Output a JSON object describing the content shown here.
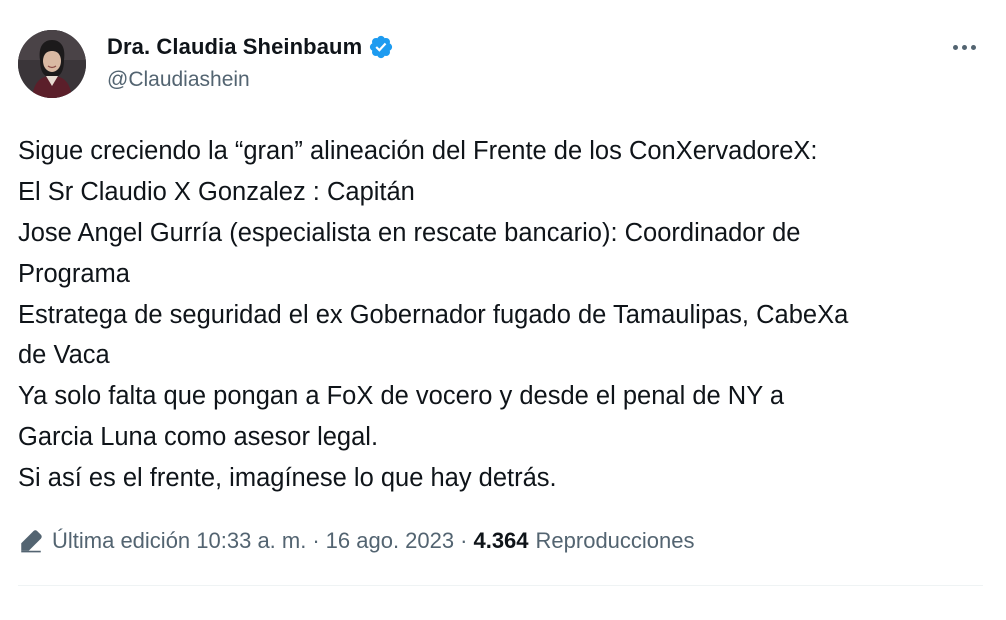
{
  "author": {
    "display_name": "Dra. Claudia Sheinbaum",
    "handle": "@Claudiashein",
    "verified": true,
    "avatar_icon": "profile-photo"
  },
  "tweet": {
    "lines": [
      "Sigue creciendo la “gran” alineación del Frente de los ConXervadoreX:",
      "El Sr Claudio X Gonzalez : Capitán",
      "Jose Angel Gurría (especialista en rescate bancario): Coordinador de",
      "Programa",
      "Estratega de seguridad el ex Gobernador  fugado de Tamaulipas, CabeXa",
      "de Vaca",
      "Ya solo falta que  pongan a FoX de vocero y desde el penal de NY a",
      "Garcia Luna como asesor legal.",
      "Si así es el frente, imagínese lo que hay detrás."
    ]
  },
  "meta": {
    "edited_label": "Última edición 10:33 a. m.",
    "separator": "·",
    "date": "16 ago. 2023",
    "views_count": "4.364",
    "views_label": "Reproducciones"
  },
  "colors": {
    "text_primary": "#0f1419",
    "text_secondary": "#536471",
    "verified_blue": "#1d9bf0"
  }
}
